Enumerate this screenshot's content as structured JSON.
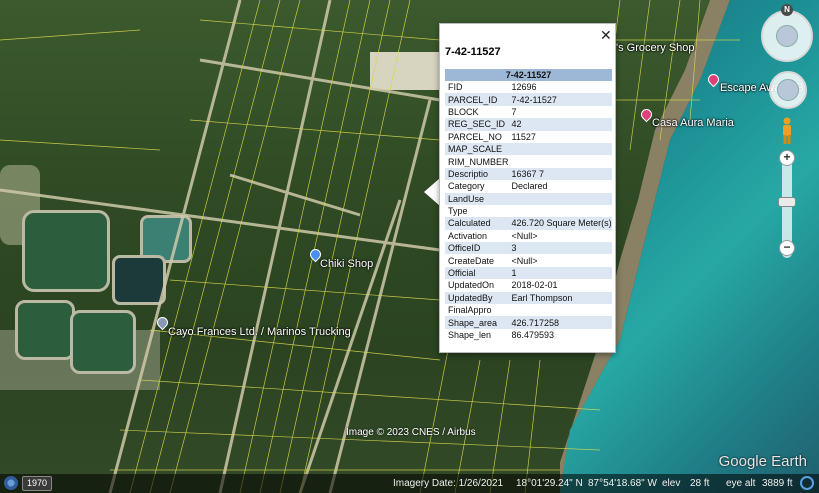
{
  "map": {
    "pois": [
      {
        "label": "'s Grocery Shop",
        "icon": "none"
      },
      {
        "label": "Escape Away BB",
        "icon": "pink-pin-icon"
      },
      {
        "label": "Casa Aura Maria",
        "icon": "pink-pin-icon"
      },
      {
        "label": "Chiki Shop",
        "icon": "blue-pin-icon"
      },
      {
        "label": "Cayo Frances Ltd. / Marinos Trucking",
        "icon": "gray-pin-icon"
      }
    ],
    "credit": "Image © 2023 CNES / Airbus",
    "brand": "Google Earth",
    "colors": {
      "parcel_lines": "#d8d84a",
      "sea": "#1f8c92",
      "balloon_header": "#9db8d6",
      "alt_row": "#dde7f3"
    }
  },
  "balloon": {
    "title": "7-42-11527",
    "table_header": "7-42-11527",
    "close_glyph": "✕",
    "rows": [
      {
        "key": "FID",
        "value": "12696"
      },
      {
        "key": "PARCEL_ID",
        "value": "7-42-11527"
      },
      {
        "key": "BLOCK",
        "value": "7"
      },
      {
        "key": "REG_SEC_ID",
        "value": "42"
      },
      {
        "key": "PARCEL_NO",
        "value": "11527"
      },
      {
        "key": "MAP_SCALE",
        "value": ""
      },
      {
        "key": "RIM_NUMBER",
        "value": ""
      },
      {
        "key": "Descriptio",
        "value": "16367 7"
      },
      {
        "key": "Category",
        "value": "Declared"
      },
      {
        "key": "LandUse",
        "value": ""
      },
      {
        "key": "Type",
        "value": ""
      },
      {
        "key": "Calculated",
        "value": "426.720 Square Meter(s)"
      },
      {
        "key": "Activation",
        "value": "<Null>"
      },
      {
        "key": "OfficeID",
        "value": "3"
      },
      {
        "key": "CreateDate",
        "value": "<Null>"
      },
      {
        "key": "Official",
        "value": "1"
      },
      {
        "key": "UpdatedOn",
        "value": "2018-02-01"
      },
      {
        "key": "UpdatedBy",
        "value": "Earl Thompson"
      },
      {
        "key": "FinalAppro",
        "value": ""
      },
      {
        "key": "Shape_area",
        "value": "426.717258"
      },
      {
        "key": "Shape_len",
        "value": "86.479593"
      }
    ]
  },
  "nav": {
    "north_label": "N",
    "zoom_in": "+",
    "zoom_out": "−"
  },
  "statusbar": {
    "year": "1970",
    "imagery_date": "Imagery Date: 1/26/2021",
    "lat": "18°01'29.24\" N",
    "lon": "87°54'18.68\" W",
    "elev_label": "elev",
    "elev_value": "28 ft",
    "eye_label": "eye alt",
    "eye_value": "3889 ft"
  }
}
